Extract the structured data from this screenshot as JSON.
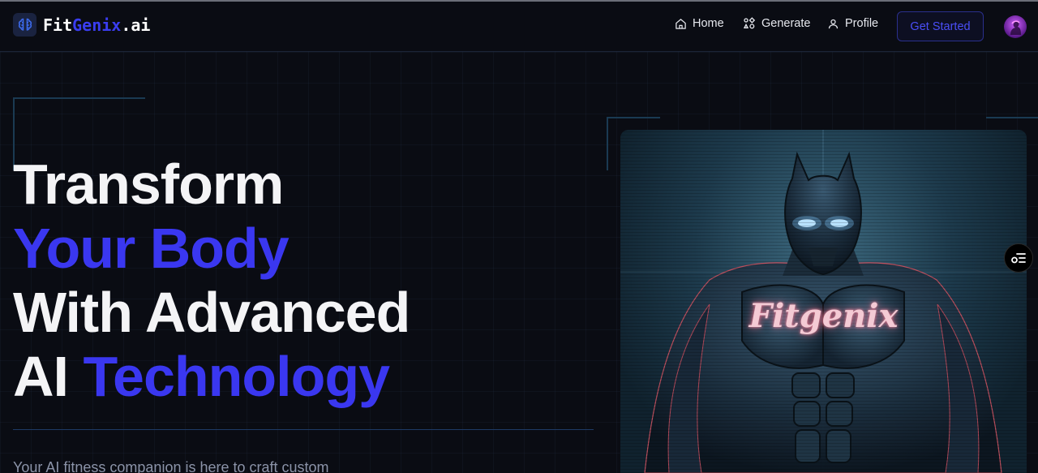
{
  "brand": {
    "fit": "Fit",
    "genix": "Genix",
    "ai": ".ai"
  },
  "nav": {
    "home": "Home",
    "generate": "Generate",
    "profile": "Profile",
    "cta": "Get Started"
  },
  "hero": {
    "line1": "Transform",
    "line2": "Your Body",
    "line3": "With Advanced",
    "line4a": "AI ",
    "line4b": "Technology",
    "subtitle": "Your AI fitness companion is here to craft custom"
  },
  "image": {
    "watermark": "Fitgenix"
  },
  "colors": {
    "accent": "#3a37f0",
    "background": "#0a0c13"
  }
}
